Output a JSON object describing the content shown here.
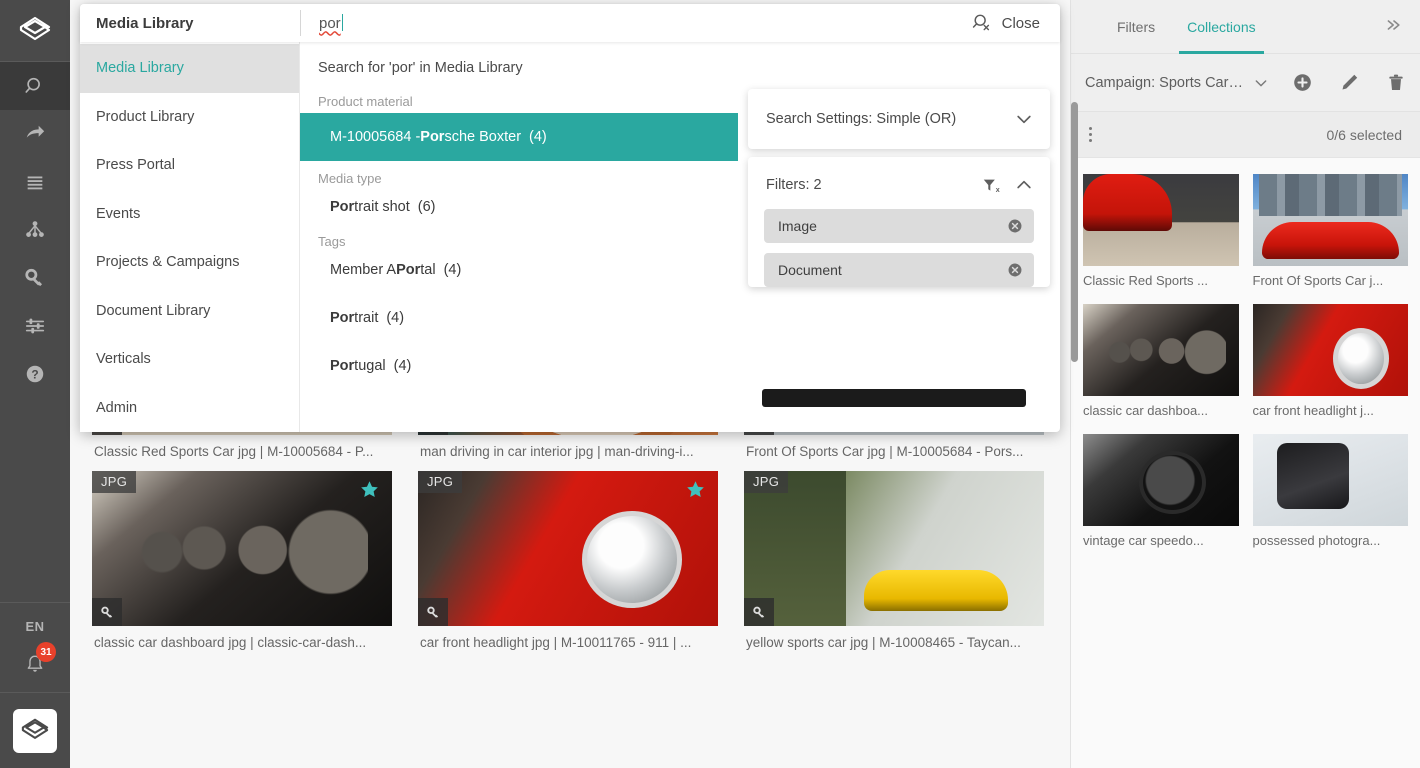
{
  "colors": {
    "accent": "#2aa8a0",
    "rail_bg": "#4a4a4a",
    "badge_red": "#e8412b",
    "selected_row": "#2aa8a0"
  },
  "rail": {
    "logo_icon": "brand-logo-icon",
    "items": [
      {
        "icon": "search-icon",
        "name": "search",
        "active": true
      },
      {
        "icon": "share-arrow-icon",
        "name": "share",
        "active": false
      },
      {
        "icon": "list-lines-icon",
        "name": "lists",
        "active": false
      },
      {
        "icon": "sitemap-icon",
        "name": "hierarchy",
        "active": false
      },
      {
        "icon": "key-icon",
        "name": "rights",
        "active": false
      },
      {
        "icon": "sliders-icon",
        "name": "settings",
        "active": false
      },
      {
        "icon": "help-circle-icon",
        "name": "help",
        "active": false
      }
    ],
    "language": "EN",
    "notification_icon": "bell-icon",
    "notification_count": "31",
    "avatar_icon": "brand-logo-icon"
  },
  "modal": {
    "context_label": "Media Library",
    "search_value": "por",
    "close_label": "Close",
    "close_icon": "search-off-icon",
    "nav_items": [
      {
        "label": "Media Library",
        "active": true
      },
      {
        "label": "Product Library",
        "active": false
      },
      {
        "label": "Press Portal",
        "active": false
      },
      {
        "label": "Events",
        "active": false
      },
      {
        "label": "Projects & Campaigns",
        "active": false
      },
      {
        "label": "Document Library",
        "active": false
      },
      {
        "label": "Verticals",
        "active": false
      },
      {
        "label": "Admin",
        "active": false
      }
    ],
    "search_all_label": "Search for 'por' in Media Library",
    "groups": [
      {
        "title": "Product material",
        "items": [
          {
            "prefix": "M-10005684 - ",
            "bold": "Por",
            "suffix": "sche Boxter",
            "count": "(4)",
            "selected": true
          }
        ]
      },
      {
        "title": "Media type",
        "items": [
          {
            "prefix": "",
            "bold": "Por",
            "suffix": "trait shot",
            "count": "(6)",
            "selected": false
          }
        ]
      },
      {
        "title": "Tags",
        "items": [
          {
            "prefix": "Member A ",
            "bold": "Por",
            "suffix": "tal",
            "count": "(4)",
            "selected": false
          },
          {
            "prefix": "",
            "bold": "Por",
            "suffix": "trait",
            "count": "(4)",
            "selected": false
          },
          {
            "prefix": "",
            "bold": "Por",
            "suffix": "tugal",
            "count": "(4)",
            "selected": false
          }
        ]
      }
    ],
    "settings": {
      "search_settings_label": "Search Settings: Simple (OR)",
      "search_settings_icon": "chevron-down-icon",
      "filters_label": "Filters: 2",
      "clear_filters_icon": "filter-clear-icon",
      "filters_collapse_icon": "chevron-up-icon",
      "chips": [
        {
          "label": "Image",
          "remove_icon": "close-circle-icon"
        },
        {
          "label": "Document",
          "remove_icon": "close-circle-icon"
        }
      ]
    }
  },
  "main_grid": {
    "cards": [
      {
        "caption": "Classic Red Sports Car jpg | M-10005684 - P...",
        "format": "",
        "photo": "ph-red-wall",
        "key_icon": "key-icon",
        "star": false
      },
      {
        "caption": "man driving in car interior jpg | man-driving-i...",
        "format": "",
        "photo": "ph-interior",
        "key_icon": "key-icon",
        "star": false
      },
      {
        "caption": "Front Of Sports Car jpg | M-10005684 - Pors...",
        "format": "",
        "photo": "ph-front-red",
        "key_icon": "key-icon",
        "star": false
      },
      {
        "caption": "classic car dashboard jpg | classic-car-dash...",
        "format": "JPG",
        "photo": "ph-dash",
        "key_icon": "key-icon",
        "star": true
      },
      {
        "caption": "car front headlight jpg | M-10011765 - 911 | ...",
        "format": "JPG",
        "photo": "ph-headlight",
        "key_icon": "key-icon",
        "star": true
      },
      {
        "caption": "yellow sports car jpg | M-10008465 - Taycan...",
        "format": "JPG",
        "photo": "ph-yellow",
        "key_icon": "key-icon",
        "star": false
      }
    ]
  },
  "right_panel": {
    "tabs": [
      {
        "label": "Filters",
        "active": false
      },
      {
        "label": "Collections",
        "active": true
      }
    ],
    "expand_icon": "chevrons-right-icon",
    "collection_name": "Campaign: Sports Car P...",
    "collection_chevron_icon": "chevron-down-icon",
    "add_icon": "plus-circle-icon",
    "edit_icon": "pencil-icon",
    "delete_icon": "trash-icon",
    "kebab_icon": "more-vertical-icon",
    "selected_count": "0/6 selected",
    "items": [
      {
        "caption": "Classic Red Sports ...",
        "photo": "ph-red-wall"
      },
      {
        "caption": "Front Of Sports Car j...",
        "photo": "ph-skyline"
      },
      {
        "caption": "classic car dashboa...",
        "photo": "ph-dash"
      },
      {
        "caption": "car front headlight j...",
        "photo": "ph-headlight"
      },
      {
        "caption": "vintage car speedo...",
        "photo": "ph-speedo"
      },
      {
        "caption": "possessed photogra...",
        "photo": "ph-charge"
      }
    ]
  }
}
